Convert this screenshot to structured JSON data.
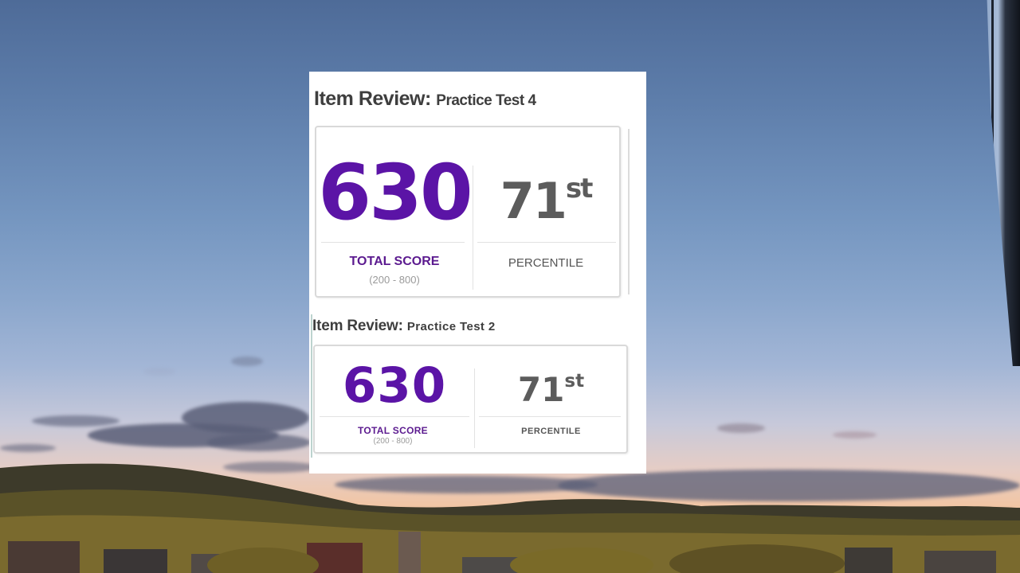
{
  "card": {
    "tests": [
      {
        "title_lead": "Item Review:",
        "title_tail": "Practice Test 4",
        "score": "630",
        "score_label": "TOTAL SCORE",
        "score_range": "(200 - 800)",
        "percentile_number": "71",
        "percentile_suffix": "st",
        "percentile_label": "PERCENTILE"
      },
      {
        "title_lead": "Item Review:",
        "title_tail": "Practice Test 2",
        "score": "630",
        "score_label": "TOTAL SCORE",
        "score_range": "(200 - 800)",
        "percentile_number": "71",
        "percentile_suffix": "st",
        "percentile_label": "PERCENTILE"
      }
    ]
  },
  "colors": {
    "score_purple": "#5b14a6",
    "percentile_gray": "#5c5c5c",
    "card_background": "#ffffff"
  }
}
